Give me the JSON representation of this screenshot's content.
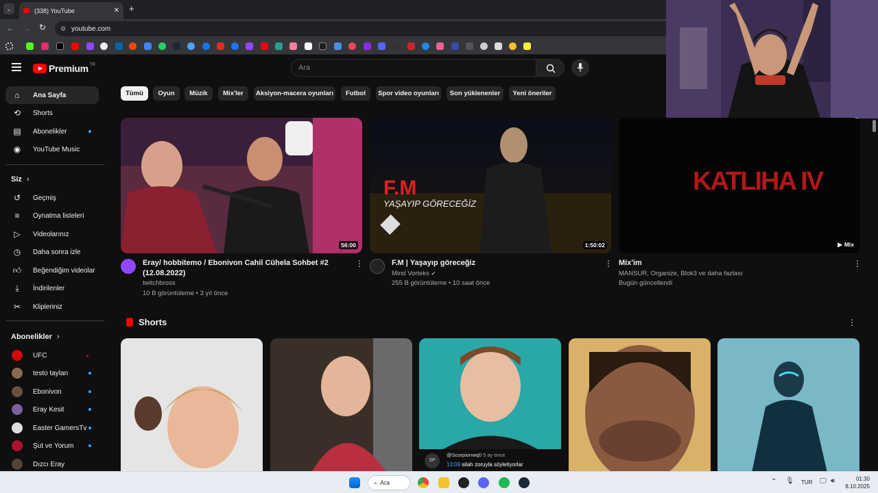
{
  "browser": {
    "tab_title": "(338) YouTube",
    "url": "youtube.com"
  },
  "header": {
    "logo_text": "Premium",
    "region": "TR",
    "search_placeholder": "Ara"
  },
  "sidebar": {
    "main": [
      {
        "label": "Ana Sayfa",
        "icon": "home-icon"
      },
      {
        "label": "Shorts",
        "icon": "shorts-icon"
      },
      {
        "label": "Abonelikler",
        "icon": "subscriptions-icon"
      },
      {
        "label": "YouTube Music",
        "icon": "music-icon"
      }
    ],
    "you_header": "Siz",
    "you": [
      {
        "label": "Geçmiş",
        "icon": "history-icon"
      },
      {
        "label": "Oynatma listeleri",
        "icon": "playlists-icon"
      },
      {
        "label": "Videolarınız",
        "icon": "your-videos-icon"
      },
      {
        "label": "Daha sonra izle",
        "icon": "watch-later-icon"
      },
      {
        "label": "Beğendiğim videolar",
        "icon": "liked-icon"
      },
      {
        "label": "İndirilenler",
        "icon": "download-icon"
      },
      {
        "label": "Klipleriniz",
        "icon": "clips-icon"
      }
    ],
    "subs_header": "Abonelikler",
    "subs": [
      {
        "label": "UFC",
        "badge": "●"
      },
      {
        "label": "testo taylan"
      },
      {
        "label": "Ebonivon"
      },
      {
        "label": "Eray Kesit"
      },
      {
        "label": "Easter GamersTv"
      },
      {
        "label": "Şut ve Yorum"
      },
      {
        "label": "Dızcı Eray"
      }
    ]
  },
  "chips": [
    "Tümü",
    "Oyun",
    "Müzik",
    "Mix'ler",
    "Aksiyon-macera oyunları",
    "Futbol",
    "Spor video oyunları",
    "Son yüklenenler",
    "Yeni öneriler"
  ],
  "videos": [
    {
      "title": "Eray/ hobbitemo / Ebonivon Cahil Cühela Sohbet #2 (12.08.2022)",
      "channel": "twitchbross",
      "meta": "10 B görüntüleme • 3 yıl önce",
      "duration": "56:00"
    },
    {
      "title": "F.M | Yaşayıp göreceğiz",
      "channel": "Mind Vorteks",
      "meta": "255 B görüntüleme • 10 saat önce",
      "duration": "1:50:02",
      "thumb_title": "F.M",
      "thumb_sub": "YAŞAYIP GÖRECEĞİZ"
    },
    {
      "title": "Mix'im",
      "channel": "MANSUR, Organize, Blok3 ve daha fazlası",
      "meta": "Bugün güncellendi",
      "duration": "Mix",
      "thumb_text": "KATLIHA IV"
    }
  ],
  "shorts": {
    "title": "Shorts",
    "comment_user": "@Scorpionwq0",
    "comment_age": "5 ay önce",
    "comment_time": "13:09",
    "comment_text": "silah zoruyla söyletiyorlar",
    "avatar_initials": "SP"
  },
  "taskbar": {
    "search": "Ara",
    "lang": "TUR",
    "time": "01:30",
    "date": "8.10.2025"
  },
  "colors": {
    "bg": "#0f0f0f",
    "accent": "#ff0000",
    "subs_dot": "#3ea6ff"
  }
}
